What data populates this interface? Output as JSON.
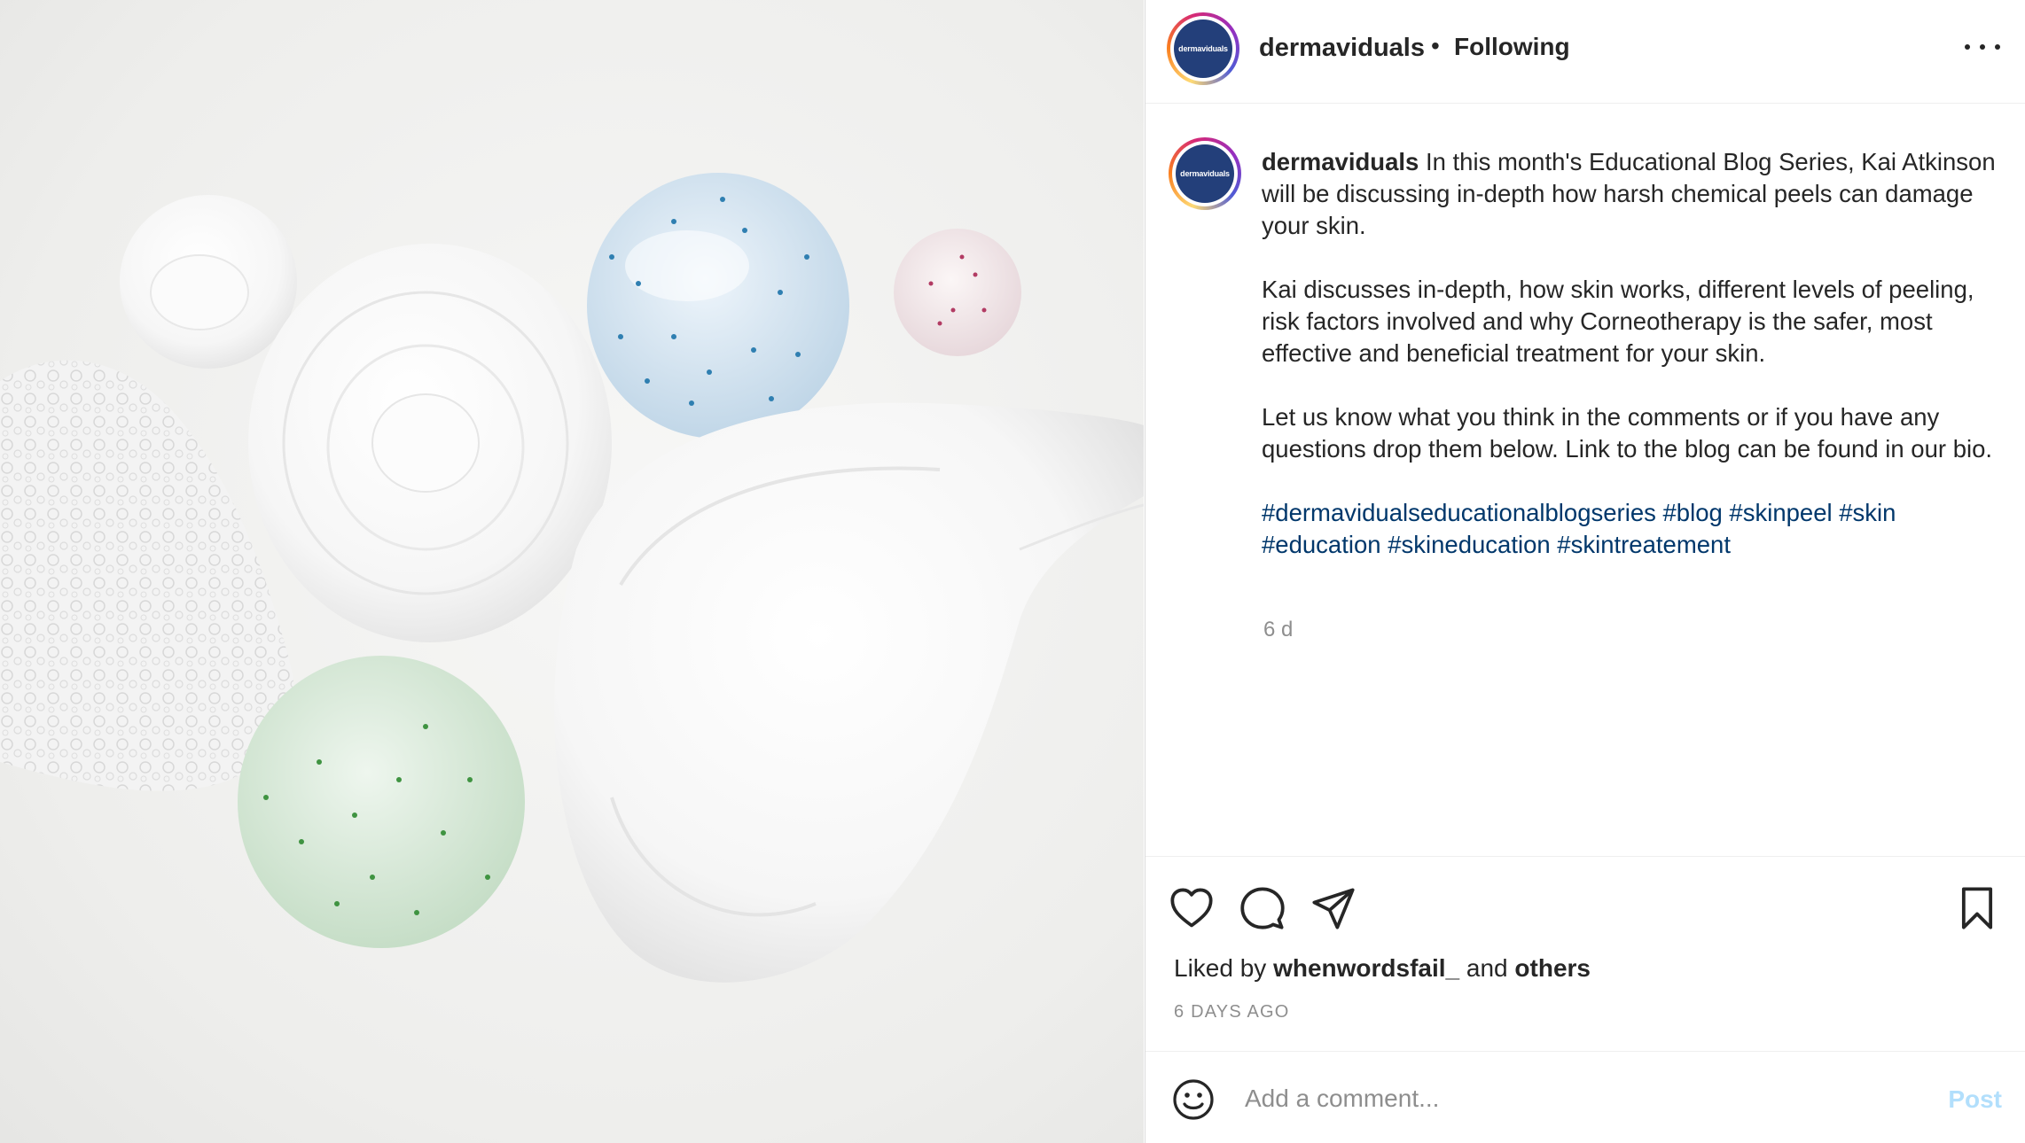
{
  "post": {
    "username": "dermaviduals",
    "avatar_text": "dermaviduals",
    "separator": "•",
    "follow_status": "Following",
    "caption": {
      "username": "dermaviduals",
      "paragraph1": "In this month's Educational Blog Series, Kai Atkinson will be discussing in-depth how harsh chemical peels can damage your skin.",
      "paragraph2": "Kai discusses in-depth, how skin works, different levels of peeling, risk factors involved and why Corneotherapy is the safer, most effective and beneficial treatment for your skin.",
      "paragraph3": "Let us know what you think in the comments or if you have any questions drop them below. Link to the blog can be found in our bio.",
      "hashtags": "#dermavidualseducationalblogseries #blog #skinpeel #skin #education #skineducation #skintreatement",
      "time_ago": "6 d"
    },
    "likes": {
      "prefix": "Liked by",
      "user": "whenwordsfail_",
      "conjunction": "and",
      "others": "others"
    },
    "date": "6 DAYS AGO",
    "comment": {
      "placeholder": "Add a comment...",
      "post_label": "Post"
    },
    "icons": {
      "more": "more-options-icon",
      "like": "heart-icon",
      "comment": "comment-bubble-icon",
      "share": "paper-plane-icon",
      "save": "bookmark-icon",
      "emoji": "smiley-icon"
    },
    "colors": {
      "hashtag": "#00376b",
      "avatar_bg": "#233f7a",
      "post_disabled": "#b2dffc"
    }
  }
}
